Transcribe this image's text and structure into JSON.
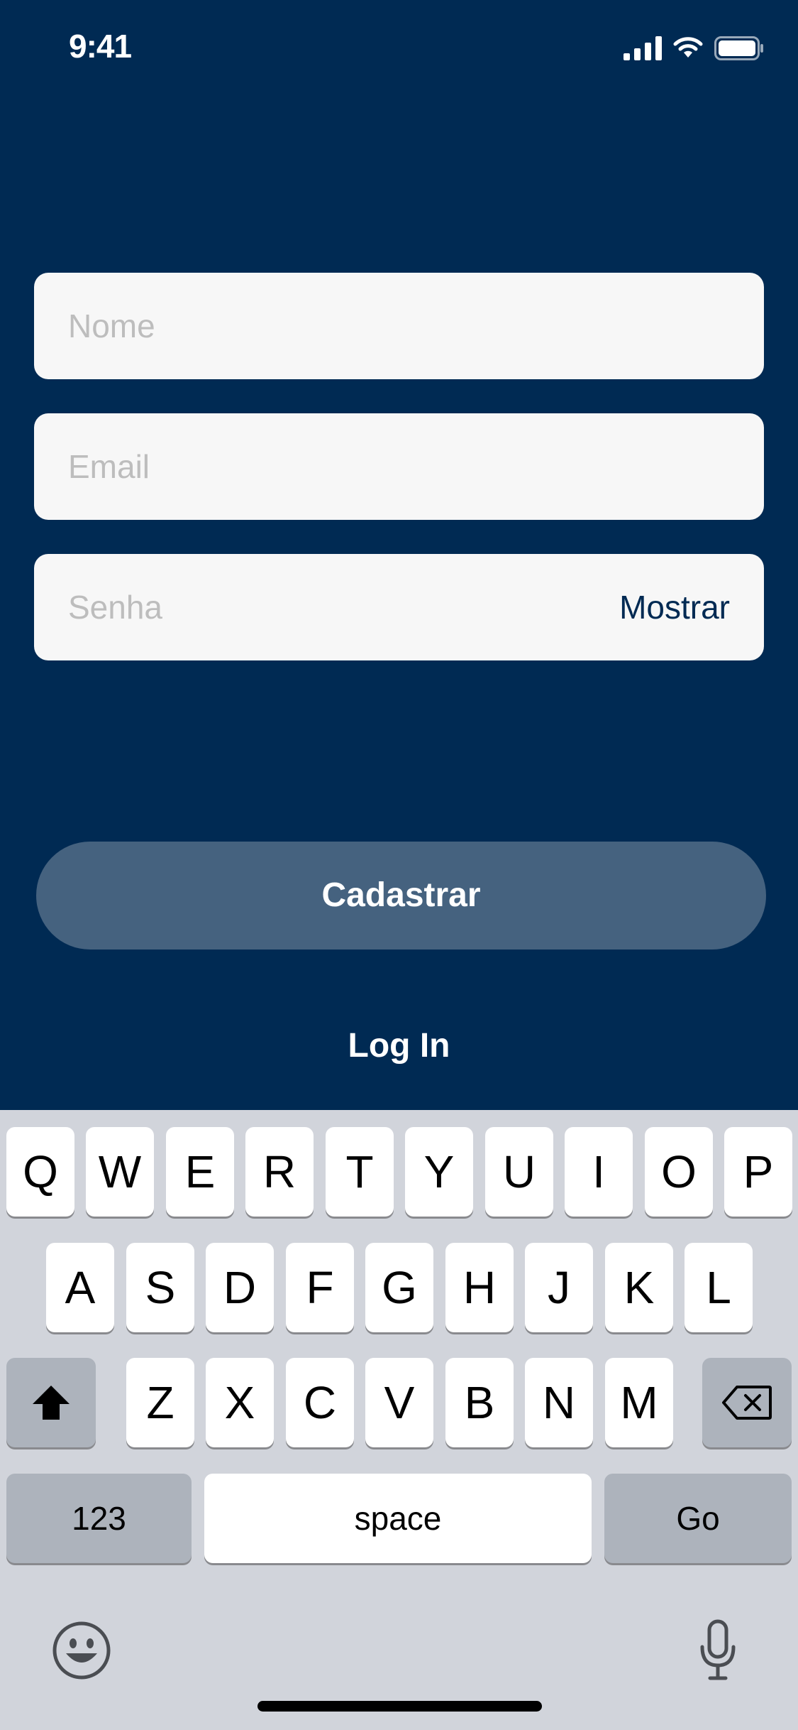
{
  "status_bar": {
    "time": "9:41"
  },
  "form": {
    "name_placeholder": "Nome",
    "email_placeholder": "Email",
    "password_placeholder": "Senha",
    "show_password_label": "Mostrar"
  },
  "buttons": {
    "register_label": "Cadastrar",
    "login_label": "Log In"
  },
  "keyboard": {
    "row1": [
      "Q",
      "W",
      "E",
      "R",
      "T",
      "Y",
      "U",
      "I",
      "O",
      "P"
    ],
    "row2": [
      "A",
      "S",
      "D",
      "F",
      "G",
      "H",
      "J",
      "K",
      "L"
    ],
    "row3": [
      "Z",
      "X",
      "C",
      "V",
      "B",
      "N",
      "M"
    ],
    "numbers_label": "123",
    "space_label": "space",
    "go_label": "Go"
  },
  "icons": [
    "signal-icon",
    "wifi-icon",
    "battery-icon",
    "shift-icon",
    "backspace-icon",
    "emoji-icon",
    "microphone-icon"
  ],
  "colors": {
    "background": "#002a53",
    "button": "#45627f",
    "field": "#f7f7f7",
    "keyboard": "#d1d4db"
  }
}
